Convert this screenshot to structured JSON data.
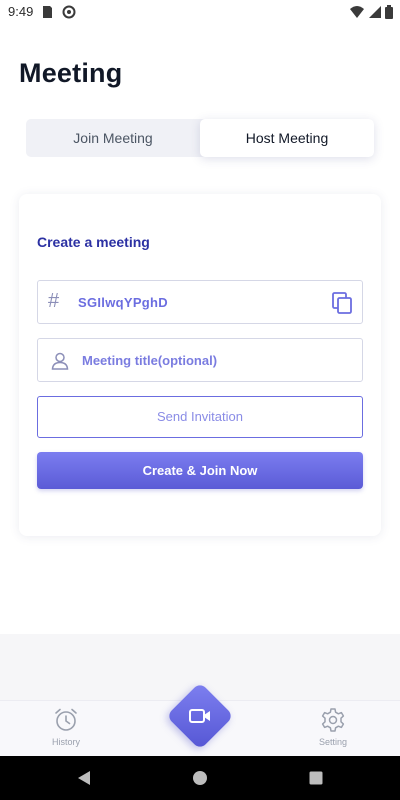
{
  "status_bar": {
    "time": "9:49"
  },
  "page": {
    "title": "Meeting"
  },
  "tabs": {
    "join_label": "Join Meeting",
    "host_label": "Host Meeting",
    "active": "Host Meeting"
  },
  "card": {
    "title": "Create a meeting",
    "meeting_code": "SGIlwqYPghD",
    "meeting_title_placeholder": "Meeting title(optional)",
    "meeting_title_value": "",
    "send_invitation_label": "Send Invitation",
    "create_join_label": "Create & Join Now"
  },
  "bottom_nav": {
    "history_label": "History",
    "setting_label": "Setting"
  },
  "icons": {
    "code": "hash-icon",
    "copy": "copy-icon",
    "user": "user-icon",
    "history": "alarm-clock-icon",
    "camera": "video-camera-icon",
    "setting": "gear-icon"
  },
  "colors": {
    "accent": "#5b5bd6",
    "title_blue": "#2c31a3",
    "text_purple": "#6b6de0"
  }
}
